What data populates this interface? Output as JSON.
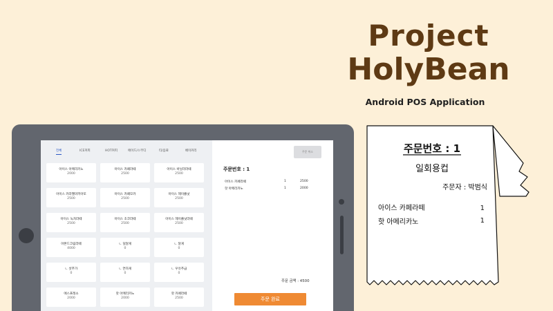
{
  "brand": {
    "line1": "Project",
    "line2": "HolyBean",
    "subtitle": "Android POS Application"
  },
  "pos": {
    "tabs": [
      "전체",
      "ICE커피",
      "HOT커피",
      "에이드/스무디",
      "티/음료",
      "베이커리"
    ],
    "active_tab": "전체",
    "items": [
      {
        "name": "아이스 아메리카노",
        "price": "2000"
      },
      {
        "name": "아이스 카페라떼",
        "price": "2500"
      },
      {
        "name": "아이스 바닐라라떼",
        "price": "2500"
      },
      {
        "name": "아이스 카라멜마끼아또",
        "price": "2500"
      },
      {
        "name": "아이스 카페모카",
        "price": "2500"
      },
      {
        "name": "아이스 헤이즐넛",
        "price": "2500"
      },
      {
        "name": "아이스 녹차라떼",
        "price": "2500"
      },
      {
        "name": "아이스 초코라떼",
        "price": "2500"
      },
      {
        "name": "아이스 헤이즐넛라떼",
        "price": "2500"
      },
      {
        "name": "아몬드크림라떼",
        "price": "4000"
      },
      {
        "name": "ㄴ 덜달게",
        "price": "0"
      },
      {
        "name": "ㄴ 달게",
        "price": "0"
      },
      {
        "name": "ㄴ 샷추가",
        "price": "0"
      },
      {
        "name": "ㄴ 연하게",
        "price": "0"
      },
      {
        "name": "ㄴ 우유추급",
        "price": "0"
      },
      {
        "name": "에스프레소",
        "price": "2000"
      },
      {
        "name": "핫 아메리카노",
        "price": "2000"
      },
      {
        "name": "핫 카페라떼",
        "price": "2500"
      }
    ],
    "top_button": "주문 취소",
    "order_number": "주문번호 : 1",
    "order_lines": [
      {
        "name": "아이스 카페라떼",
        "qty": "1",
        "price": "2500"
      },
      {
        "name": "핫 아메리카노",
        "qty": "1",
        "price": "2000"
      }
    ],
    "total": "주문 금액 : 4500",
    "complete_button": "주문 완료"
  },
  "receipt": {
    "order_number": "주문번호 : 1",
    "cup_type": "일회용컵",
    "orderer": "주문자 : 박범식",
    "lines": [
      {
        "name": "아이스 카페라떼",
        "qty": "1"
      },
      {
        "name": "핫 아메리카노",
        "qty": "1"
      }
    ]
  }
}
